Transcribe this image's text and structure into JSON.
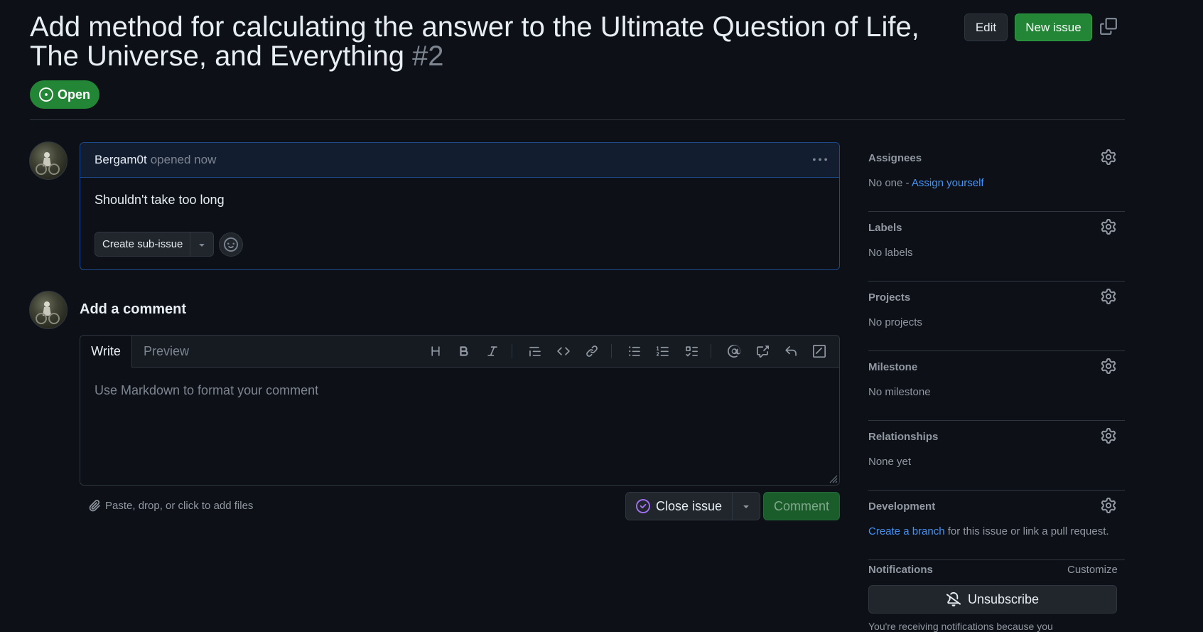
{
  "issue": {
    "title": "Add method for calculating the answer to the Ultimate Question of Life, The Universe, and Everything",
    "number": "#2",
    "state": "Open"
  },
  "header_buttons": {
    "edit": "Edit",
    "new_issue": "New issue"
  },
  "comment": {
    "author": "Bergam0t",
    "opened": "opened now",
    "body": "Shouldn't take too long",
    "create_sub_issue": "Create sub-issue"
  },
  "add_comment": {
    "title": "Add a comment",
    "tab_write": "Write",
    "tab_preview": "Preview",
    "placeholder": "Use Markdown to format your comment",
    "attach": "Paste, drop, or click to add files",
    "close_issue": "Close issue",
    "comment_button": "Comment"
  },
  "sidebar": {
    "assignees": {
      "title": "Assignees",
      "value": "No one -",
      "link": "Assign yourself"
    },
    "labels": {
      "title": "Labels",
      "value": "No labels"
    },
    "projects": {
      "title": "Projects",
      "value": "No projects"
    },
    "milestone": {
      "title": "Milestone",
      "value": "No milestone"
    },
    "relationships": {
      "title": "Relationships",
      "value": "None yet"
    },
    "development": {
      "title": "Development",
      "link": "Create a branch",
      "value": "for this issue or link a pull request."
    },
    "notifications": {
      "title": "Notifications",
      "customize": "Customize",
      "unsubscribe": "Unsubscribe",
      "note": "You're receiving notifications because you"
    }
  },
  "colors": {
    "background": "#0d1117",
    "accent_green": "#238636",
    "link_blue": "#4493f8",
    "close_icon_purple": "#a371f7"
  },
  "icons": [
    "copy-icon",
    "issue-open-icon",
    "kebab-icon",
    "triangle-down-icon",
    "smiley-icon",
    "heading-icon",
    "bold-icon",
    "italic-icon",
    "quote-icon",
    "code-icon",
    "link-icon",
    "bulleted-list-icon",
    "numbered-list-icon",
    "task-list-icon",
    "mention-icon",
    "cross-reference-icon",
    "reply-icon",
    "slash-command-icon",
    "paperclip-icon",
    "issue-closed-icon",
    "gear-icon",
    "bell-slash-icon"
  ]
}
